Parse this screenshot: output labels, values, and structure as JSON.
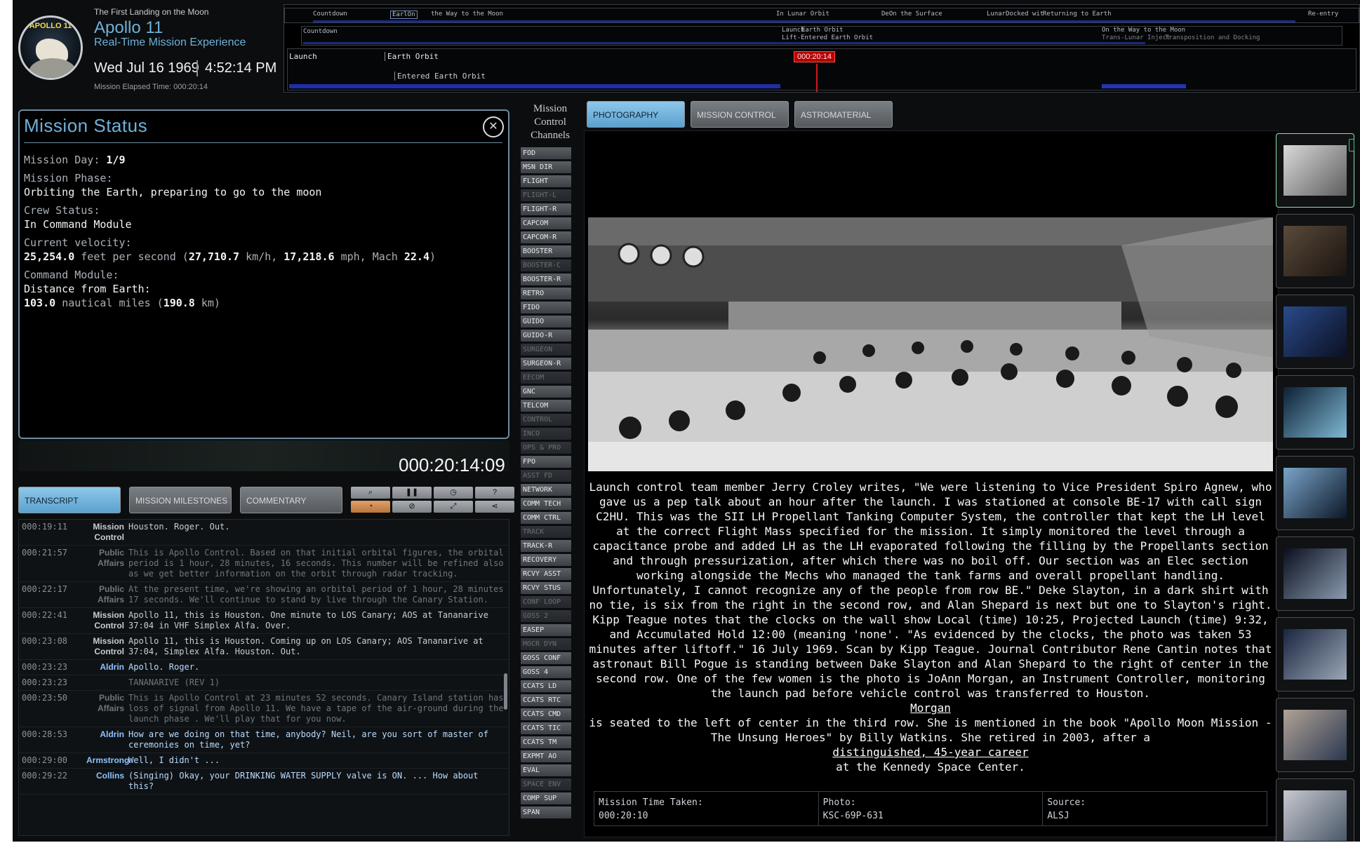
{
  "header": {
    "kicker": "The First Landing on the Moon",
    "title": "Apollo 11",
    "subtitle": "Real-Time Mission Experience",
    "date": "Wed Jul 16 1969",
    "time": "4:52:14 PM",
    "met_label": "Mission Elapsed Time: 000:20:14",
    "patch_text": "APOLLO 11"
  },
  "timeline": {
    "row1": [
      "Countdown",
      "EarlOn",
      "the Way to the Moon",
      "In Lunar Orbit",
      "DeOn the Surface",
      "LunarDocked wit",
      "Returning to Earth",
      "Re-entry"
    ],
    "row2": [
      "Countdown",
      "Launch",
      "Earth Orbit",
      "Lift-Entered Earth Orbit",
      "On the Way to the Moon",
      "Trans-Lunar Inject",
      "Transposition and Docking"
    ],
    "row3_left": "Launch",
    "row3_mid": "Earth Orbit",
    "row3_event": "Entered Earth Orbit",
    "marker": "000:20:14"
  },
  "status": {
    "title": "Mission Status",
    "close_icon": "close-icon",
    "mission_day_label": "Mission Day:",
    "mission_day": "1/9",
    "phase_label": "Mission Phase:",
    "phase": "Orbiting the Earth, preparing to go to the moon",
    "crew_label": "Crew Status:",
    "crew": "In Command Module",
    "velocity_label": "Current velocity:",
    "velocity_fps": "25,254.0",
    "velocity_fps_unit": "feet per second (",
    "velocity_kmh": "27,710.7",
    "velocity_kmh_unit": "km/h,",
    "velocity_mph": "17,218.6",
    "velocity_mph_unit": "mph, Mach",
    "mach": "22.4",
    "velocity_close": ")",
    "module_label": "Command Module:",
    "distance_label": "Distance from Earth:",
    "distance_nm": "103.0",
    "distance_nm_unit": "nautical miles (",
    "distance_km": "190.8",
    "distance_km_unit": "km)",
    "big_clock": "000:20:14:09"
  },
  "tabs": {
    "transcript": "TRANSCRIPT",
    "milestones": "MISSION MILESTONES",
    "commentary": "COMMENTARY"
  },
  "media_tabs": {
    "photography": "PHOTOGRAPHY",
    "audio": "MISSION CONTROL AUDIO",
    "samples": "ASTROMATERIAL SAMPLES"
  },
  "channels_title": "Mission Control Channels",
  "channels": [
    {
      "label": "FOD",
      "on": true
    },
    {
      "label": "MSN DIR",
      "on": true
    },
    {
      "label": "FLIGHT",
      "on": true
    },
    {
      "label": "FLIGHT-L",
      "on": false
    },
    {
      "label": "FLIGHT-R",
      "on": true
    },
    {
      "label": "CAPCOM",
      "on": true
    },
    {
      "label": "CAPCOM-R",
      "on": true
    },
    {
      "label": "BOOSTER",
      "on": true
    },
    {
      "label": "BOOSTER-C",
      "on": false
    },
    {
      "label": "BOOSTER-R",
      "on": true
    },
    {
      "label": "RETRO",
      "on": true
    },
    {
      "label": "FIDO",
      "on": true
    },
    {
      "label": "GUIDO",
      "on": true
    },
    {
      "label": "GUIDO-R",
      "on": true
    },
    {
      "label": "SURGEON",
      "on": false
    },
    {
      "label": "SURGEON-R",
      "on": true
    },
    {
      "label": "EECOM",
      "on": false
    },
    {
      "label": "GNC",
      "on": true
    },
    {
      "label": "TELCOM",
      "on": true
    },
    {
      "label": "CONTROL",
      "on": false
    },
    {
      "label": "INCO",
      "on": false
    },
    {
      "label": "OPS & PRO",
      "on": false
    },
    {
      "label": "FPO",
      "on": true
    },
    {
      "label": "ASST FD",
      "on": false
    },
    {
      "label": "NETWORK",
      "on": true
    },
    {
      "label": "COMM TECH",
      "on": true
    },
    {
      "label": "COMM CTRL",
      "on": true
    },
    {
      "label": "TRACK",
      "on": false
    },
    {
      "label": "TRACK-R",
      "on": true
    },
    {
      "label": "RECOVERY",
      "on": true
    },
    {
      "label": "RCVY ASST",
      "on": true
    },
    {
      "label": "RCVY STUS",
      "on": true
    },
    {
      "label": "CONF LOOP",
      "on": false
    },
    {
      "label": "GOSS 2",
      "on": false
    },
    {
      "label": "EASEP",
      "on": true
    },
    {
      "label": "MOCR DYN",
      "on": false
    },
    {
      "label": "GOSS CONF",
      "on": true
    },
    {
      "label": "GOSS 4",
      "on": true
    },
    {
      "label": "CCATS LD",
      "on": true
    },
    {
      "label": "CCATS RTC",
      "on": true
    },
    {
      "label": "CCATS CMD",
      "on": true
    },
    {
      "label": "CCATS TIC",
      "on": true
    },
    {
      "label": "CCATS TM",
      "on": true
    },
    {
      "label": "EXPMT AO",
      "on": true
    },
    {
      "label": "EVAL",
      "on": true
    },
    {
      "label": "SPACE ENV",
      "on": false
    },
    {
      "label": "COMP SUP",
      "on": true
    },
    {
      "label": "SPAN",
      "on": true
    }
  ],
  "transcript": [
    {
      "t": "000:19:11",
      "s": "Mission Control",
      "m": "Houston. Roger. Out.",
      "kind": "normal"
    },
    {
      "t": "000:21:57",
      "s": "Public Affairs",
      "m": "This is Apollo Control. Based on that initial orbital figures, the orbital period is 1 hour, 28 minutes, 16 seconds. This number will be refined also as we get better information on the orbit through radar tracking.",
      "kind": "dim"
    },
    {
      "t": "000:22:17",
      "s": "Public Affairs",
      "m": "At the present time, we're showing an orbital period of 1 hour, 28 minutes 17 seconds. We'll continue to stand by live through the Canary Station.",
      "kind": "dim"
    },
    {
      "t": "000:22:41",
      "s": "Mission Control",
      "m": "Apollo 11, this is Houston. One minute to LOS Canary; AOS at Tananarive 37:04 in VHF Simplex Alfa. Over.",
      "kind": "normal"
    },
    {
      "t": "000:23:08",
      "s": "Mission Control",
      "m": "Apollo 11, this is Houston. Coming up on LOS Canary; AOS Tananarive at 37:04, Simplex Alfa. Houston. Out.",
      "kind": "normal"
    },
    {
      "t": "000:23:23",
      "s": "Aldrin",
      "m": "Apollo. Roger.",
      "kind": "crew"
    },
    {
      "t": "000:23:23",
      "s": "",
      "m": "TANANARIVE (REV 1)",
      "kind": "dim"
    },
    {
      "t": "000:23:50",
      "s": "Public Affairs",
      "m": "This is Apollo Control at 23 minutes 52 seconds. Canary Island station has loss of signal from Apollo 11. We have a tape of the air-ground during the launch phase . We'll play that for you now.",
      "kind": "dim"
    },
    {
      "t": "000:28:53",
      "s": "Aldrin",
      "m": "How are we doing on that time, anybody? Neil, are you sort of master of ceremonies on time, yet?",
      "kind": "crew"
    },
    {
      "t": "000:29:00",
      "s": "Armstrong",
      "m": "Well, I didn't ...",
      "kind": "crew"
    },
    {
      "t": "000:29:22",
      "s": "Collins",
      "m": "(Singing) Okay, your DRINKING WATER SUPPLY valve is ON. ... How about this?",
      "kind": "crew"
    }
  ],
  "tools": [
    "search-icon",
    "pause-icon",
    "history-icon",
    "help-icon",
    "speed-icon",
    "mute-icon",
    "fullscreen-icon",
    "share-icon"
  ],
  "caption": {
    "text": "Launch control team member Jerry Croley writes, \"We were listening to Vice President Spiro Agnew, who gave us a pep talk about an hour after the launch. I was stationed at console BE-17 with call sign C2HU. This was the SII LH Propellant Tanking Computer System, the controller that kept the LH level at the correct Flight Mass specified for the mission. It simply monitored the level through a capacitance probe and added LH as the LH evaporated following the filling by the Propellants section and through pressurization, after which there was no boil off. Our section was an Elec section working alongside the Mechs who managed the tank farms and overall propellant handling. Unfortunately, I cannot recognize any of the people from row BE.\" Deke Slayton, in a dark shirt with no tie, is six from the right in the second row, and Alan Shepard is next but one to Slayton's right. Kipp Teague notes that the clocks on the wall show Local (time) 10:25, Projected Launch (time) 9:32, and Accumulated Hold 12:00 (meaning 'none'. \"As evidenced by the clocks, the photo was taken 53 minutes after liftoff.\" 16 July 1969. Scan by Kipp Teague. Journal Contributor Rene Cantin notes that astronaut Bill Pogue is standing between Dake Slayton and Alan Shepard to the right of center in the second row. One of the few women is the photo is JoAnn Morgan, an Instrument Controller, monitoring the launch pad before vehicle control was transferred to Houston.",
    "link1": "Morgan",
    "text2": "is seated to the left of center in the third row. She is mentioned in the book \"Apollo Moon Mission - The Unsung Heroes\" by Billy Watkins. She retired in 2003, after a",
    "link2": "distinguished, 45-year career",
    "text3": "at the Kennedy Space Center."
  },
  "photo_meta": {
    "time_label": "Mission Time Taken:",
    "time": "000:20:10",
    "photo_label": "Photo:",
    "photo": "KSC-69P-631",
    "source_label": "Source:",
    "source": "ALSJ"
  },
  "thumbs": [
    {
      "c1": "#d9d9d9",
      "c2": "#5e5e5e"
    },
    {
      "c1": "#5a4a3a",
      "c2": "#1a1410"
    },
    {
      "c1": "#2a4a8a",
      "c2": "#0a1020"
    },
    {
      "c1": "#0c2034",
      "c2": "#7fb8d4"
    },
    {
      "c1": "#7aa4c8",
      "c2": "#0b1828"
    },
    {
      "c1": "#0a0f1e",
      "c2": "#8a9ab0"
    },
    {
      "c1": "#1a2540",
      "c2": "#9aa6b6"
    },
    {
      "c1": "#b0a296",
      "c2": "#2a3850"
    },
    {
      "c1": "#c8c8d0",
      "c2": "#4a5868"
    }
  ]
}
